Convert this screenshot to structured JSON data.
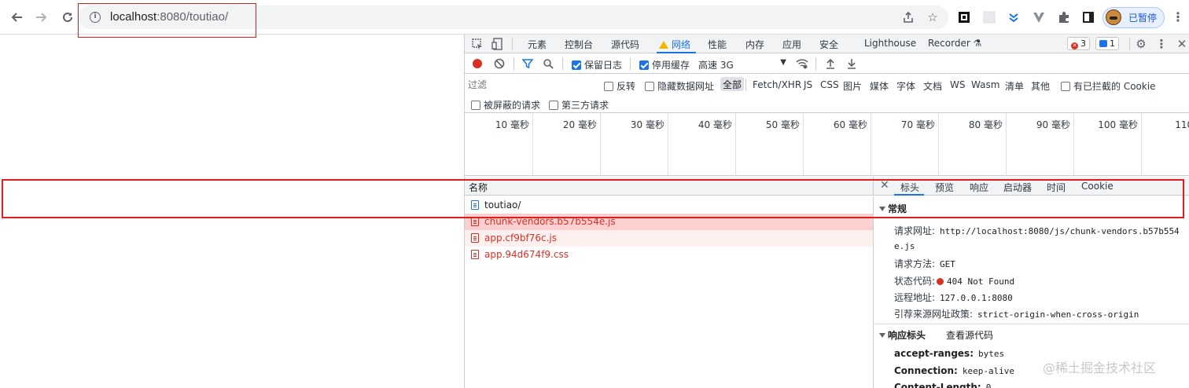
{
  "browser": {
    "url_host": "localhost",
    "url_rest": ":8080/toutiao/",
    "profile_label": "已暂停"
  },
  "devtools": {
    "tabs": [
      "元素",
      "控制台",
      "源代码",
      "网络",
      "性能",
      "内存",
      "应用",
      "安全",
      "Lighthouse",
      "Recorder"
    ],
    "active_tab": "网络",
    "error_count": "3",
    "message_count": "1",
    "toolbar": {
      "preserve_log": "保留日志",
      "disable_cache": "停用缓存",
      "throttle": "高速 3G"
    },
    "filter": {
      "placeholder": "过滤",
      "invert": "反转",
      "hide_data_urls": "隐藏数据网址",
      "types": [
        "全部",
        "Fetch/XHR",
        "JS",
        "CSS",
        "图片",
        "媒体",
        "字体",
        "文档",
        "WS",
        "Wasm",
        "清单",
        "其他"
      ],
      "blocked_cookies": "有已拦截的 Cookie",
      "blocked_requests": "被屏蔽的请求",
      "third_party": "第三方请求"
    },
    "timeline_ticks": [
      "10 毫秒",
      "20 毫秒",
      "30 毫秒",
      "40 毫秒",
      "50 毫秒",
      "60 毫秒",
      "70 毫秒",
      "80 毫秒",
      "90 毫秒",
      "100 毫秒",
      "110 毫"
    ],
    "requests_header": "名称",
    "requests": [
      {
        "name": "toutiao/",
        "error": false
      },
      {
        "name": "chunk-vendors.b57b554e.js",
        "error": true
      },
      {
        "name": "app.cf9bf76c.js",
        "error": true
      },
      {
        "name": "app.94d674f9.css",
        "error": true
      }
    ],
    "detail_tabs": [
      "标头",
      "预览",
      "响应",
      "启动器",
      "时间",
      "Cookie"
    ],
    "general": {
      "title": "常规",
      "request_url_key": "请求网址:",
      "request_url_value_1": "http://localhost:8080/js/chunk-vendors.b57b554",
      "request_url_value_2": "e.js",
      "method_key": "请求方法:",
      "method_value": "GET",
      "status_key": "状态代码:",
      "status_value": "404 Not Found",
      "remote_key": "远程地址:",
      "remote_value": "127.0.0.1:8080",
      "referrer_key": "引荐来源网址政策:",
      "referrer_value": "strict-origin-when-cross-origin"
    },
    "response_headers": {
      "title": "响应标头",
      "view_source": "查看源代码",
      "items": [
        {
          "k": "accept-ranges:",
          "v": "bytes"
        },
        {
          "k": "Connection:",
          "v": "keep-alive"
        },
        {
          "k": "Content-Length:",
          "v": "0"
        }
      ]
    }
  },
  "watermark": "@稀土掘金技术社区"
}
